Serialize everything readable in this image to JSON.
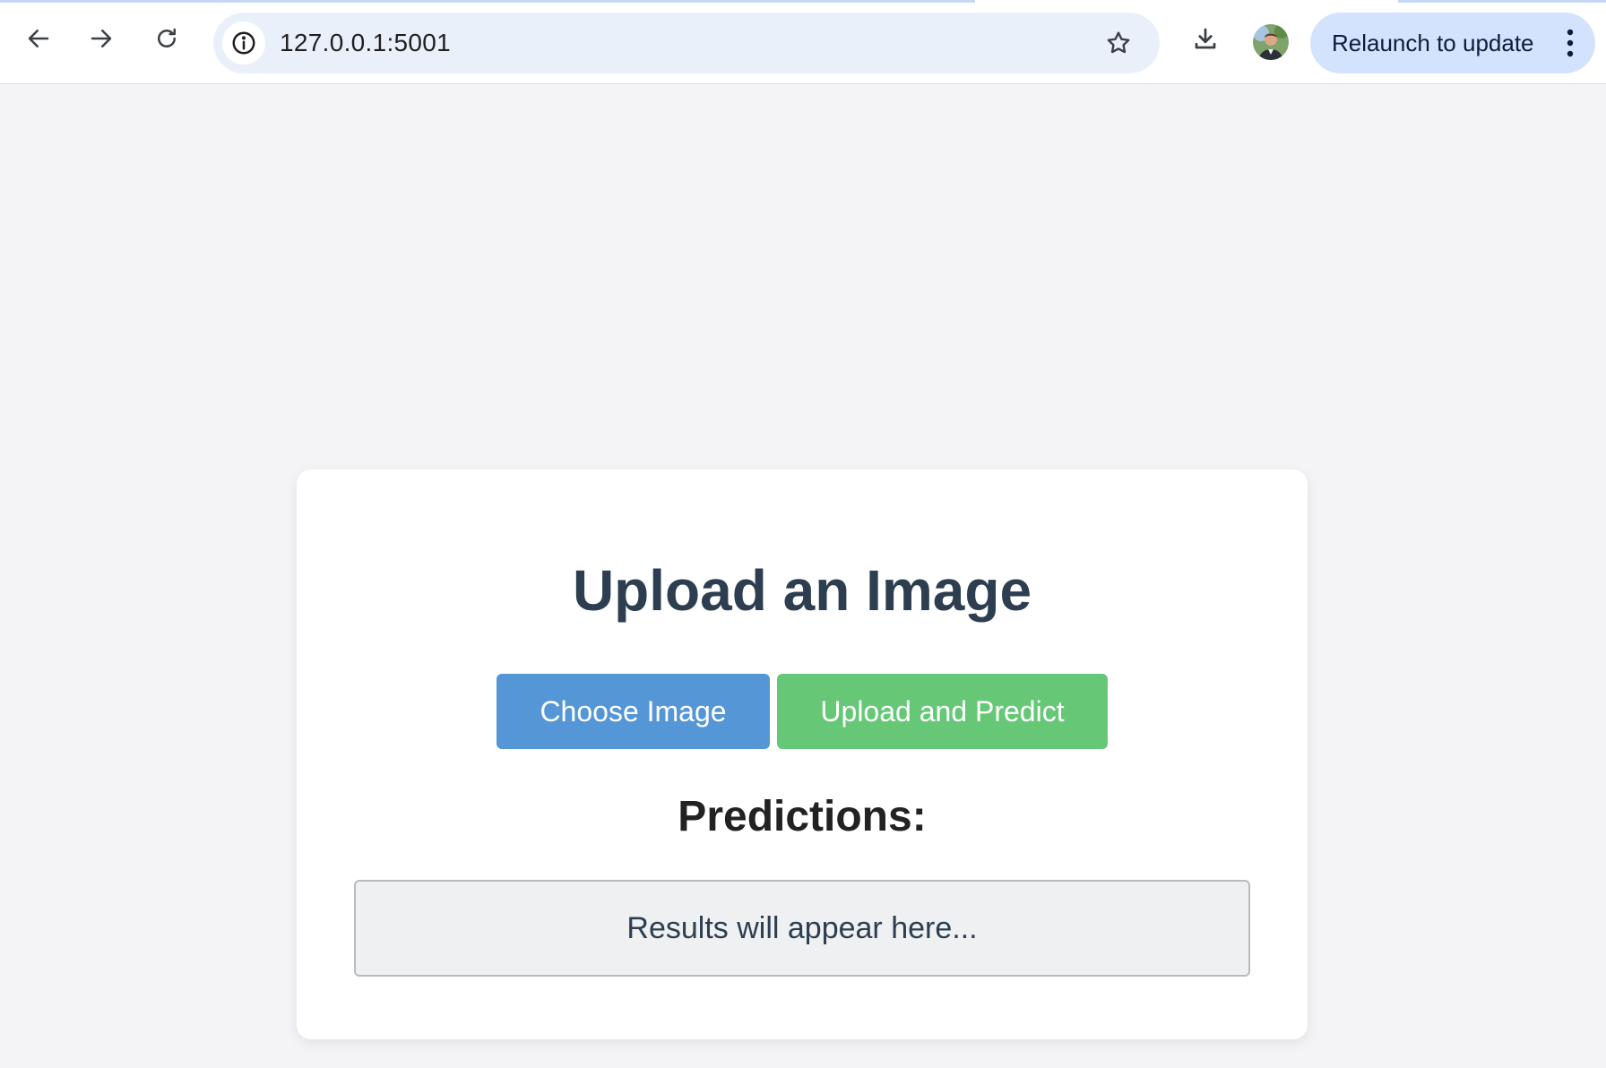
{
  "browser": {
    "url": "127.0.0.1:5001",
    "relaunch_label": "Relaunch to update",
    "icons": {
      "back": "arrow-left-icon",
      "forward": "arrow-right-icon",
      "reload": "reload-icon",
      "site_info": "info-icon",
      "bookmark": "star-icon",
      "download": "download-icon",
      "profile": "avatar",
      "menu": "more-vert-icon"
    }
  },
  "page": {
    "title": "Upload an Image",
    "choose_button": "Choose Image",
    "upload_button": "Upload and Predict",
    "predictions_heading": "Predictions:",
    "results_placeholder": "Results will appear here..."
  },
  "colors": {
    "choose_button": "#5496d6",
    "upload_button": "#66c877",
    "title_text": "#2c3e50",
    "relaunch_bg": "#d3e3fd",
    "omnibox_bg": "#eaf0fa"
  }
}
